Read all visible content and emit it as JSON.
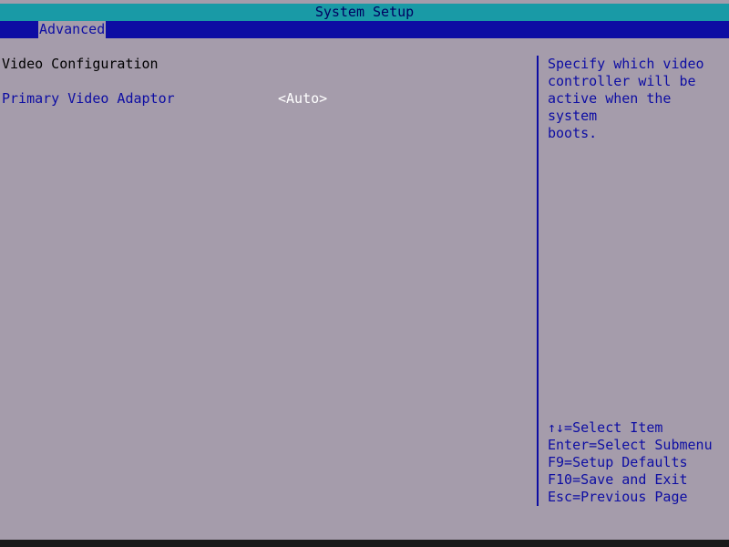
{
  "window": {
    "title": "System Setup"
  },
  "menu": {
    "items": [
      {
        "label": "Advanced",
        "selected": true
      }
    ]
  },
  "main": {
    "section_title": "Video Configuration",
    "settings": [
      {
        "label": "Primary Video Adaptor",
        "value": "<Auto>"
      }
    ]
  },
  "help": {
    "text": "Specify which video\ncontroller will be\nactive when the system\nboots."
  },
  "keys": [
    "↑↓=Select Item",
    "Enter=Select Submenu",
    "F9=Setup Defaults",
    "F10=Save and Exit",
    "Esc=Previous Page"
  ],
  "colors": {
    "background": "#a59cab",
    "title_bar": "#199aa6",
    "menu_bar": "#0d0da3",
    "text_blue": "#0d0da3",
    "value_text": "#ffffff"
  }
}
